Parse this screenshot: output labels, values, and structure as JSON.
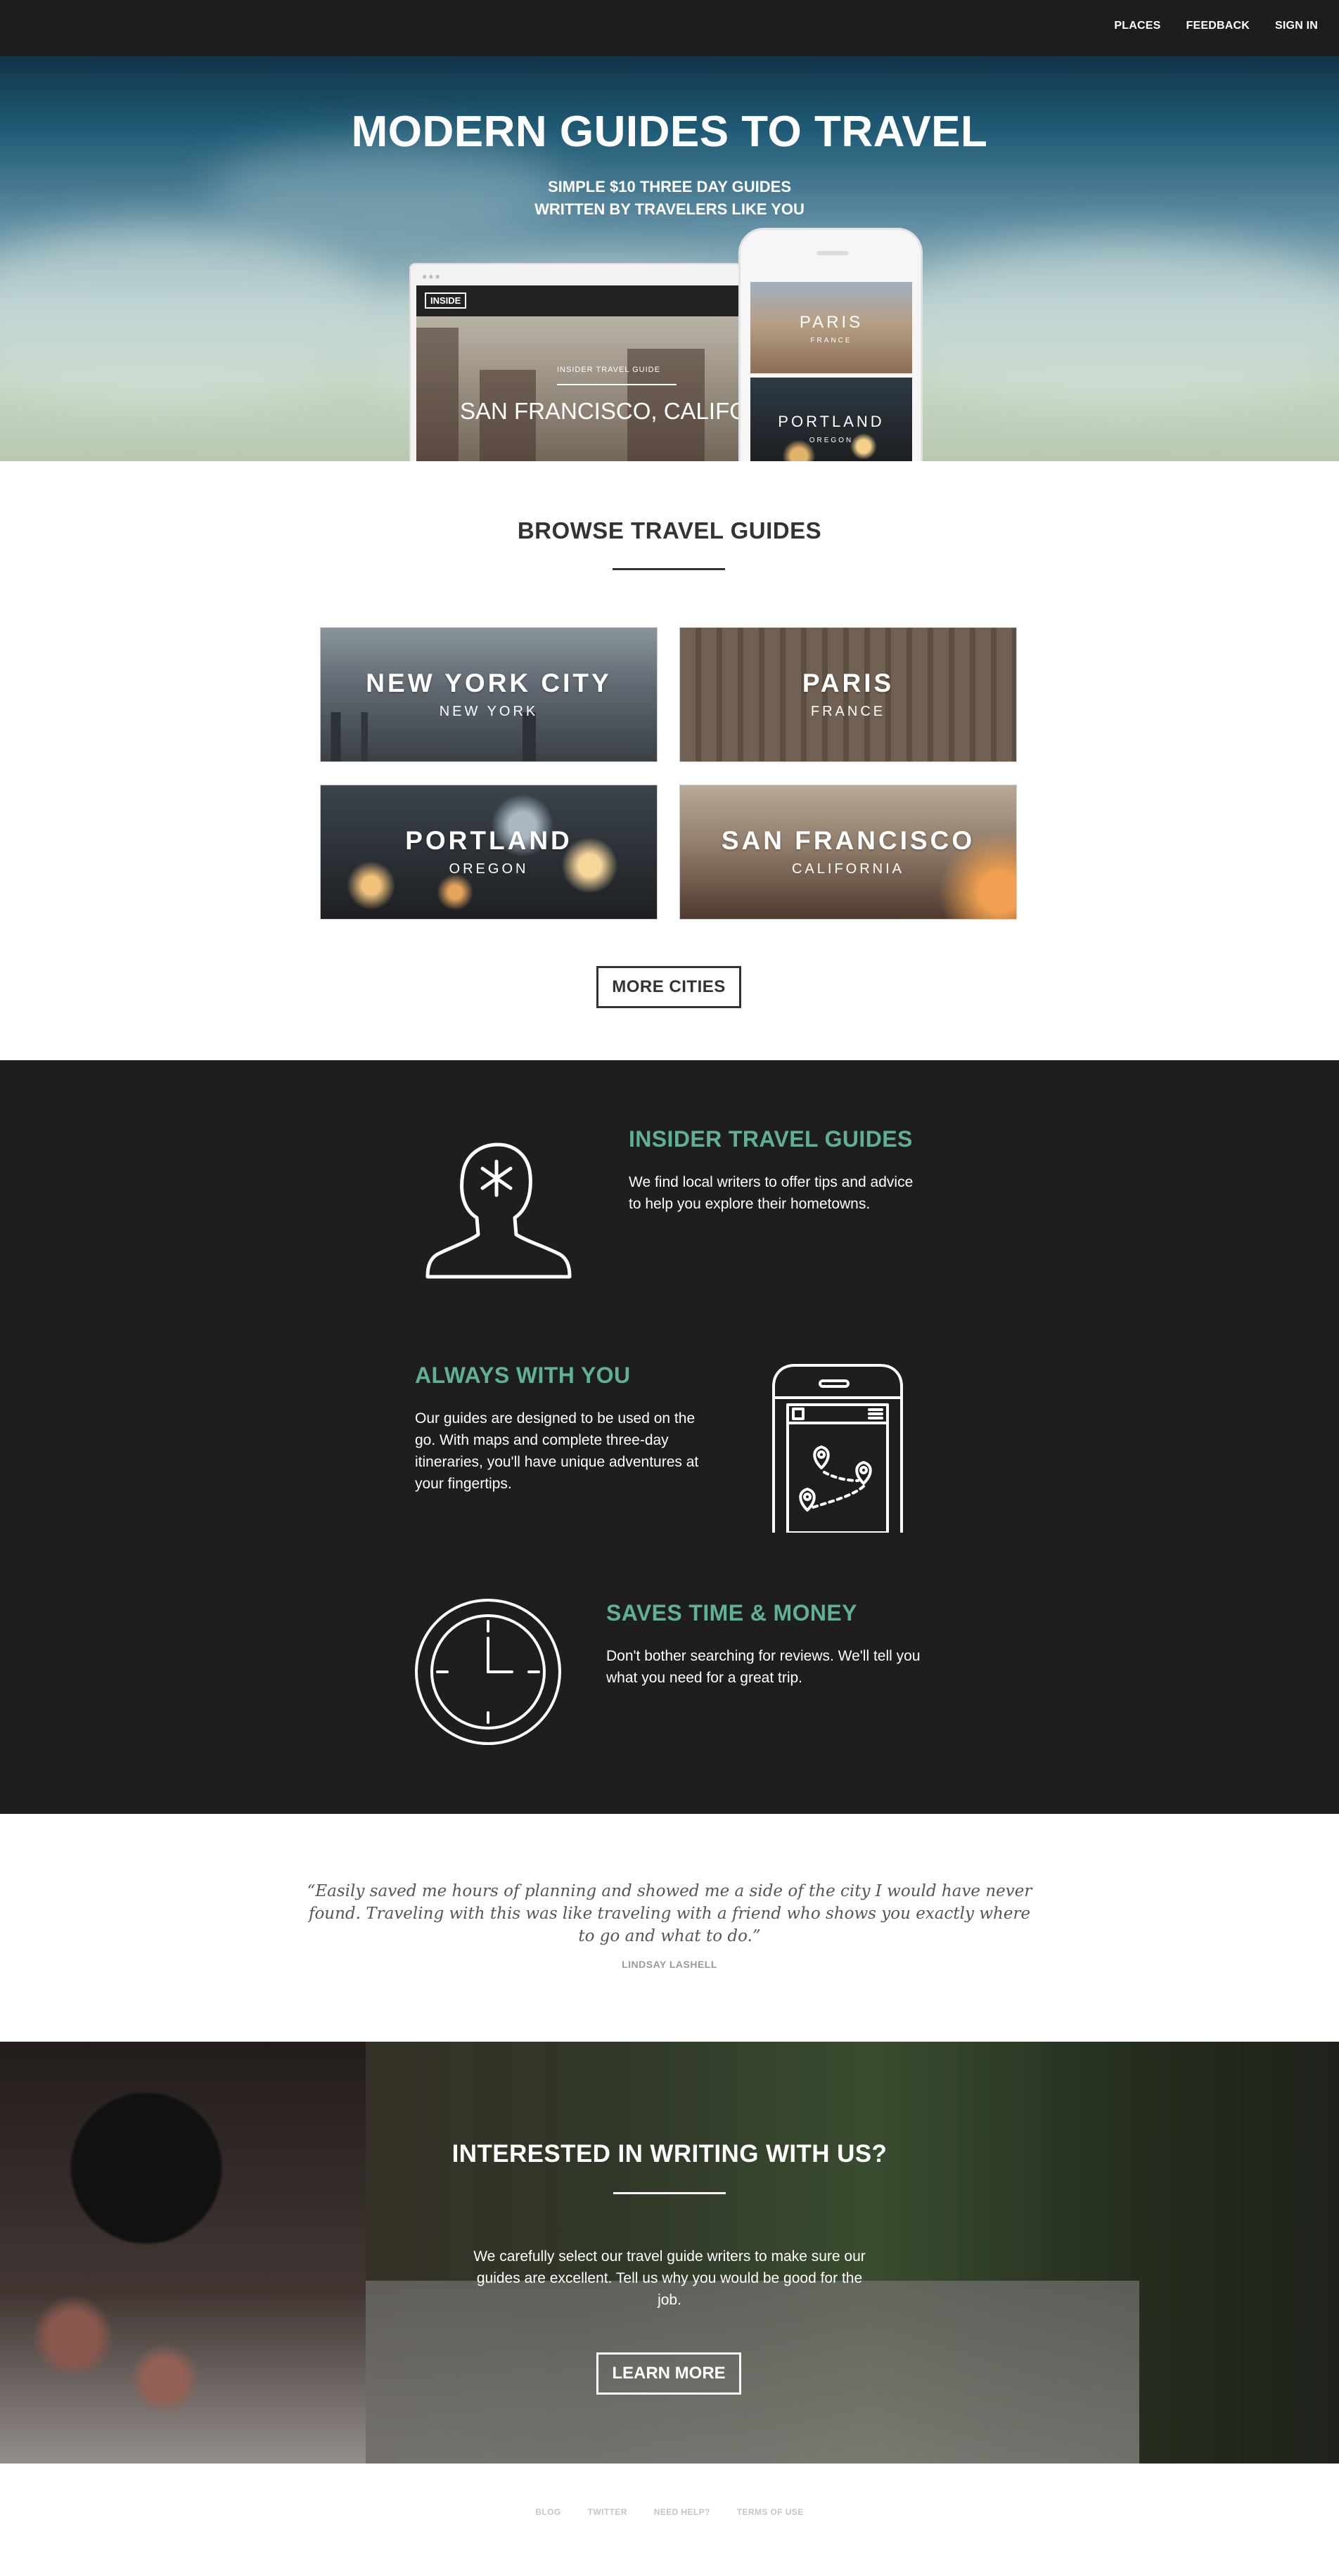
{
  "nav": {
    "links": [
      "PLACES",
      "FEEDBACK",
      "SIGN IN"
    ]
  },
  "hero": {
    "title": "MODERN GUIDES TO TRAVEL",
    "subtitle_line1": "SIMPLE $10 THREE DAY GUIDES",
    "subtitle_line2": "WRITTEN BY TRAVELERS LIKE YOU",
    "laptop": {
      "badge": "INSIDE",
      "guide_label": "INSIDER TRAVEL GUIDE",
      "city": "SAN FRANCISCO, CALIFORNIA"
    },
    "phone": {
      "cards": [
        {
          "title": "PARIS",
          "subtitle": "FRANCE"
        },
        {
          "title": "PORTLAND",
          "subtitle": "OREGON"
        }
      ]
    }
  },
  "browse": {
    "title": "BROWSE TRAVEL GUIDES",
    "cities": [
      {
        "name": "NEW YORK CITY",
        "region": "NEW YORK"
      },
      {
        "name": "PARIS",
        "region": "FRANCE"
      },
      {
        "name": "PORTLAND",
        "region": "OREGON"
      },
      {
        "name": "SAN FRANCISCO",
        "region": "CALIFORNIA"
      }
    ],
    "more_button": "MORE CITIES"
  },
  "features": [
    {
      "title": "INSIDER TRAVEL GUIDES",
      "body": "We find local writers to offer tips and advice to help you explore their hometowns.",
      "icon": "person-icon"
    },
    {
      "title": "ALWAYS WITH YOU",
      "body": "Our guides are designed to be used on the go. With maps and complete three-day itineraries, you'll have unique adventures at your fingertips.",
      "icon": "phone-map-icon"
    },
    {
      "title": "SAVES TIME & MONEY",
      "body": "Don't bother searching for reviews. We'll tell you what you need for a great trip.",
      "icon": "clock-icon"
    }
  ],
  "testimonial": {
    "quote": "“Easily saved me hours of planning and showed me a side of the city I would have never found. Traveling with this was like traveling with a friend who shows you exactly where to go and what to do.”",
    "author": "LINDSAY LASHELL"
  },
  "writing": {
    "title": "INTERESTED IN WRITING WITH US?",
    "body": "We carefully select our travel guide writers to make sure our guides are excellent. Tell us why you would be good for the job.",
    "button": "LEARN MORE"
  },
  "footer": {
    "links": [
      "BLOG",
      "TWITTER",
      "NEED HELP?",
      "TERMS OF USE"
    ]
  },
  "colors": {
    "accent": "#5fb096",
    "dark_bg": "#1e1e1e",
    "topbar": "#1d1d1d"
  }
}
